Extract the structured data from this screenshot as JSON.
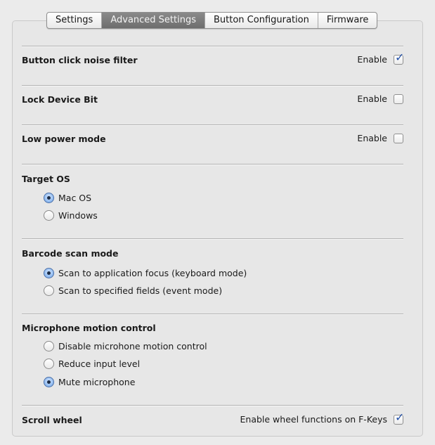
{
  "tabs": [
    {
      "label": "Settings",
      "selected": false
    },
    {
      "label": "Advanced Settings",
      "selected": true
    },
    {
      "label": "Button Configuration",
      "selected": false
    },
    {
      "label": "Firmware",
      "selected": false
    }
  ],
  "noise_filter": {
    "label": "Button click noise filter",
    "enable_label": "Enable",
    "checked": true
  },
  "lock_bit": {
    "label": "Lock Device Bit",
    "enable_label": "Enable",
    "checked": false
  },
  "low_power": {
    "label": "Low power mode",
    "enable_label": "Enable",
    "checked": false
  },
  "target_os": {
    "label": "Target OS",
    "options": [
      {
        "label": "Mac OS",
        "selected": true
      },
      {
        "label": "Windows",
        "selected": false
      }
    ]
  },
  "barcode": {
    "label": "Barcode scan mode",
    "options": [
      {
        "label": "Scan to application focus (keyboard mode)",
        "selected": true
      },
      {
        "label": "Scan to specified fields (event mode)",
        "selected": false
      }
    ]
  },
  "microphone": {
    "label": "Microphone motion control",
    "options": [
      {
        "label": "Disable microhone motion control",
        "selected": false
      },
      {
        "label": "Reduce input level",
        "selected": false
      },
      {
        "label": "Mute microphone",
        "selected": true
      }
    ]
  },
  "scroll_wheel": {
    "label": "Scroll wheel",
    "enable_label": "Enable wheel functions on F-Keys",
    "checked": true
  },
  "icons": {
    "check": "checkmark-icon"
  },
  "colors": {
    "selected_tab": "#7a7a7a",
    "check": "#2452a9",
    "radio_on": "#8bb7ee"
  }
}
